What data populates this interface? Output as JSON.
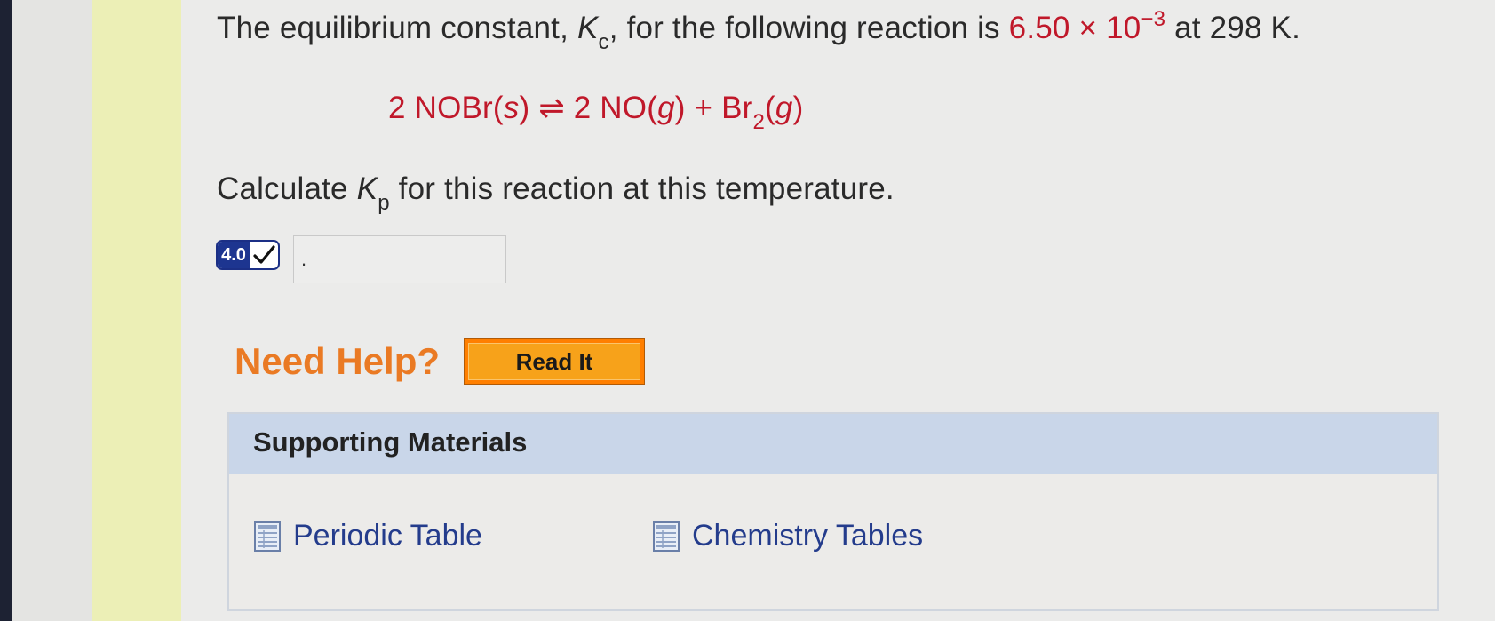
{
  "question": {
    "line1_prefix": "The equilibrium constant, ",
    "k_symbol": "K",
    "kc_subscript": "c",
    "line1_mid": ", for the following reaction is ",
    "k_value_mantissa": "6.50 × 10",
    "k_value_exponent": "−3",
    "line1_suffix": " at 298 K.",
    "equation": {
      "reactant": "2 NOBr(",
      "reactant_state": "s",
      "reactant_close": ")",
      "arrow": "⇌",
      "product1": " 2 NO(",
      "product1_state": "g",
      "product1_close": ") + Br",
      "br_subscript": "2",
      "product2_open": "(",
      "product2_state": "g",
      "product2_close": ")"
    },
    "line2_prefix": "Calculate ",
    "kp_symbol": "K",
    "kp_subscript": "p",
    "line2_suffix": " for this reaction at this temperature."
  },
  "answer": {
    "score": "4.0",
    "input_value": "."
  },
  "help": {
    "label": "Need Help?",
    "read_it": "Read It"
  },
  "supporting": {
    "title": "Supporting Materials",
    "links": [
      "Periodic Table",
      "Chemistry Tables"
    ]
  },
  "colors": {
    "accent_red": "#c0182a",
    "help_orange": "#ea7a24",
    "button_orange": "#f7a21a",
    "link_blue": "#243c8c",
    "badge_navy": "#1d3590",
    "panel_header": "#c9d6e9"
  }
}
